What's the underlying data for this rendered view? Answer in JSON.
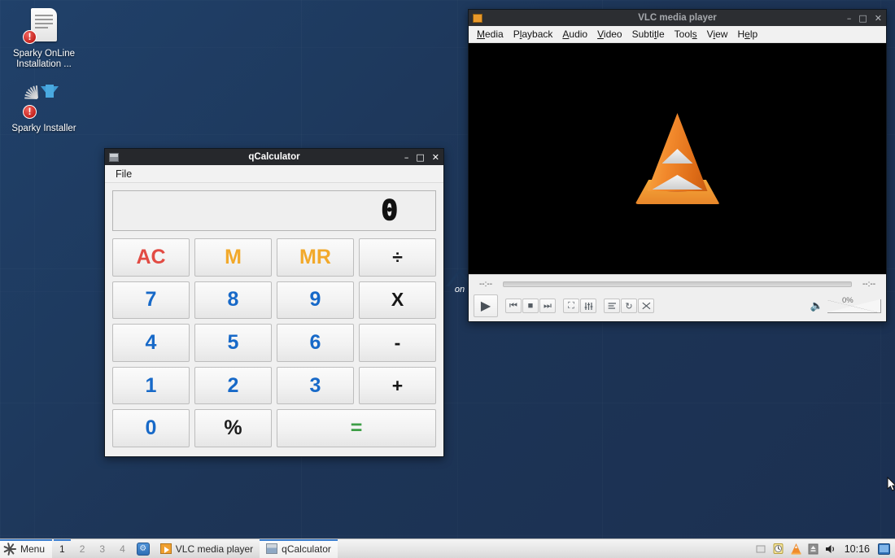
{
  "desktop": {
    "icons": [
      {
        "name": "sparky-online-installation",
        "label": "Sparky OnLine Installation ...",
        "badge": "!"
      },
      {
        "name": "sparky-installer",
        "label": "Sparky Installer",
        "badge": "!"
      }
    ],
    "panel_edge": {
      "label": "on"
    }
  },
  "calculator": {
    "title": "qCalculator",
    "menu": [
      "File"
    ],
    "display_value": "0",
    "window_buttons": {
      "minimize": "–",
      "maximize": "□",
      "close": "✕"
    },
    "keys": [
      {
        "label": "AC",
        "kind": "ac"
      },
      {
        "label": "M",
        "kind": "mem"
      },
      {
        "label": "MR",
        "kind": "mem"
      },
      {
        "label": "÷",
        "kind": "op"
      },
      {
        "label": "7",
        "kind": "num"
      },
      {
        "label": "8",
        "kind": "num"
      },
      {
        "label": "9",
        "kind": "num"
      },
      {
        "label": "X",
        "kind": "op"
      },
      {
        "label": "4",
        "kind": "num"
      },
      {
        "label": "5",
        "kind": "num"
      },
      {
        "label": "6",
        "kind": "num"
      },
      {
        "label": "-",
        "kind": "op"
      },
      {
        "label": "1",
        "kind": "num"
      },
      {
        "label": "2",
        "kind": "num"
      },
      {
        "label": "3",
        "kind": "num"
      },
      {
        "label": "+",
        "kind": "op"
      },
      {
        "label": "0",
        "kind": "num"
      },
      {
        "label": "%",
        "kind": "pct"
      },
      {
        "label": "=",
        "kind": "eq"
      }
    ]
  },
  "vlc": {
    "title": "VLC media player",
    "window_buttons": {
      "minimize": "–",
      "maximize": "□",
      "close": "✕"
    },
    "menu": [
      {
        "pre": "",
        "mn": "M",
        "post": "edia"
      },
      {
        "pre": "P",
        "mn": "l",
        "post": "ayback"
      },
      {
        "pre": "",
        "mn": "A",
        "post": "udio"
      },
      {
        "pre": "",
        "mn": "V",
        "post": "ideo"
      },
      {
        "pre": "Subti",
        "mn": "t",
        "post": "le"
      },
      {
        "pre": "Tool",
        "mn": "s",
        "post": ""
      },
      {
        "pre": "V",
        "mn": "i",
        "post": "ew"
      },
      {
        "pre": "H",
        "mn": "e",
        "post": "lp"
      }
    ],
    "time_elapsed": "--:--",
    "time_total": "--:--",
    "volume_pct": "0%",
    "controls": [
      {
        "name": "play-button",
        "glyph": "▶"
      },
      {
        "name": "previous-button",
        "glyph": "⏮"
      },
      {
        "name": "stop-button",
        "glyph": "■"
      },
      {
        "name": "next-button",
        "glyph": "⏭"
      },
      {
        "name": "fullscreen-button",
        "glyph": "⛶"
      },
      {
        "name": "equalizer-button",
        "glyph": "☰"
      },
      {
        "name": "playlist-button",
        "glyph": "☰"
      },
      {
        "name": "loop-button",
        "glyph": "↻"
      },
      {
        "name": "shuffle-button",
        "glyph": "⤨"
      }
    ]
  },
  "taskbar": {
    "menu_label": "Menu",
    "workspaces": [
      {
        "label": "1",
        "active": true
      },
      {
        "label": "2",
        "active": false
      },
      {
        "label": "3",
        "active": false
      },
      {
        "label": "4",
        "active": false
      }
    ],
    "tasks": [
      {
        "label": "VLC media player",
        "active": false
      },
      {
        "label": "qCalculator",
        "active": true
      }
    ],
    "clock": "10:16",
    "tray_icons": [
      "blank-square-icon",
      "clipboard-icon",
      "vlc-cone-icon",
      "eject-icon",
      "volume-icon"
    ]
  }
}
